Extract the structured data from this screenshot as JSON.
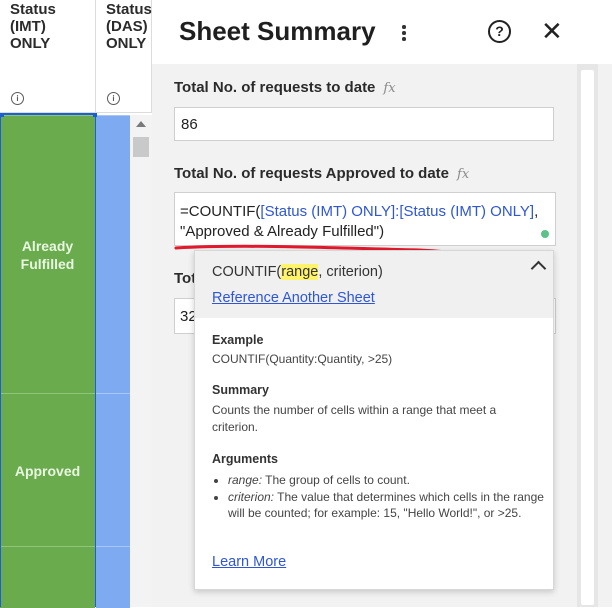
{
  "sheet": {
    "columns": [
      {
        "title": "Status\n(IMT)\nONLY"
      },
      {
        "title": "Status\n(DAS)\nONLY"
      }
    ],
    "cells": [
      {
        "value": "Already Fulfilled"
      },
      {
        "value": "Approved"
      }
    ],
    "colors": {
      "green": "#6aac4d",
      "blue": "#7eaaf2",
      "selection": "#1a5fd8"
    }
  },
  "panel": {
    "title": "Sheet Summary",
    "menu_icon": "kebab-menu-icon",
    "help_icon": "question-circle-icon",
    "close_icon": "close-icon",
    "fields": [
      {
        "label": "Total No. of requests to date",
        "value": "86"
      },
      {
        "label": "Total No. of requests Approved to date"
      },
      {
        "label": "Tot",
        "value": "32"
      }
    ],
    "formula": {
      "prefix": "=COUNTIF(",
      "range": "[Status (IMT) ONLY]:[Status (IMT) ONLY]",
      "rest": ", \"Approved & Already Fulfilled\")"
    }
  },
  "popup": {
    "signature_prefix": "COUNTIF(",
    "signature_highlight": "range",
    "signature_rest": ", criterion)",
    "reference_link": "Reference Another Sheet",
    "example_title": "Example",
    "example_text": "COUNTIF(Quantity:Quantity, >25)",
    "summary_title": "Summary",
    "summary_text": "Counts the number of cells within a range that meet a criterion.",
    "arguments_title": "Arguments",
    "arguments": [
      {
        "name": "range:",
        "desc": " The group of cells to count."
      },
      {
        "name": "criterion:",
        "desc": " The value that determines which cells in the range will be counted; for example: 15, \"Hello World!\", or >25."
      }
    ],
    "learn_more": "Learn More"
  }
}
